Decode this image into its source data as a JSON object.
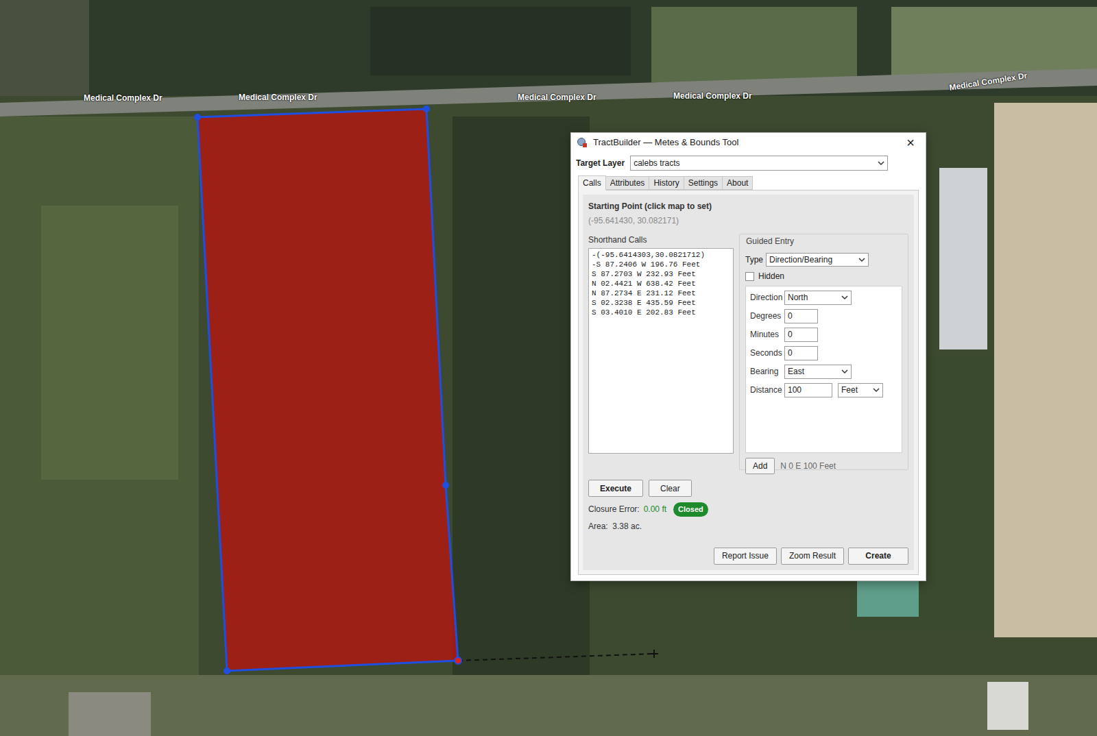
{
  "map": {
    "road_labels": [
      "Medical Complex Dr",
      "Medical Complex Dr",
      "Medical Complex Dr",
      "Medical Complex Dr",
      "Medical Complex Dr"
    ]
  },
  "window": {
    "title": "TractBuilder — Metes & Bounds Tool",
    "close": "×"
  },
  "target_layer": {
    "label": "Target Layer",
    "value": "calebs tracts"
  },
  "tabs": [
    {
      "label": "Calls",
      "selected": true
    },
    {
      "label": "Attributes",
      "selected": false
    },
    {
      "label": "History",
      "selected": false
    },
    {
      "label": "Settings",
      "selected": false
    },
    {
      "label": "About",
      "selected": false
    }
  ],
  "starting_point": {
    "label": "Starting Point (click map to set)",
    "coords": "(-95.641430, 30.082171)"
  },
  "shorthand": {
    "label": "Shorthand Calls",
    "lines": [
      "-(-95.6414303,30.0821712)",
      "-S 87.2406 W 196.76 Feet",
      "S 87.2703 W 232.93 Feet",
      "N 02.4421 W 638.42 Feet",
      "N 87.2734 E 231.12 Feet",
      "S 02.3238 E 435.59 Feet",
      "S 03.4010 E 202.83 Feet"
    ]
  },
  "guided": {
    "label": "Guided Entry",
    "type_label": "Type",
    "type_value": "Direction/Bearing",
    "hidden_label": "Hidden",
    "hidden_checked": false,
    "fields": [
      {
        "label": "Direction",
        "kind": "select",
        "value": "North"
      },
      {
        "label": "Degrees",
        "kind": "input",
        "value": "0"
      },
      {
        "label": "Minutes",
        "kind": "input",
        "value": "0"
      },
      {
        "label": "Seconds",
        "kind": "input",
        "value": "0"
      },
      {
        "label": "Bearing",
        "kind": "select",
        "value": "East"
      },
      {
        "label": "Distance",
        "kind": "unit",
        "value": "100",
        "unit": "Feet"
      }
    ],
    "add_button": "Add",
    "preview": "N 0 E 100 Feet"
  },
  "actions": [
    "Execute",
    "Clear"
  ],
  "closure": {
    "label": "Closure Error:",
    "value": "0.00 ft",
    "badge": "Closed"
  },
  "area": "Area:  3.38 ac.",
  "footer_buttons": [
    "Report Issue",
    "Zoom Result",
    "Create"
  ]
}
